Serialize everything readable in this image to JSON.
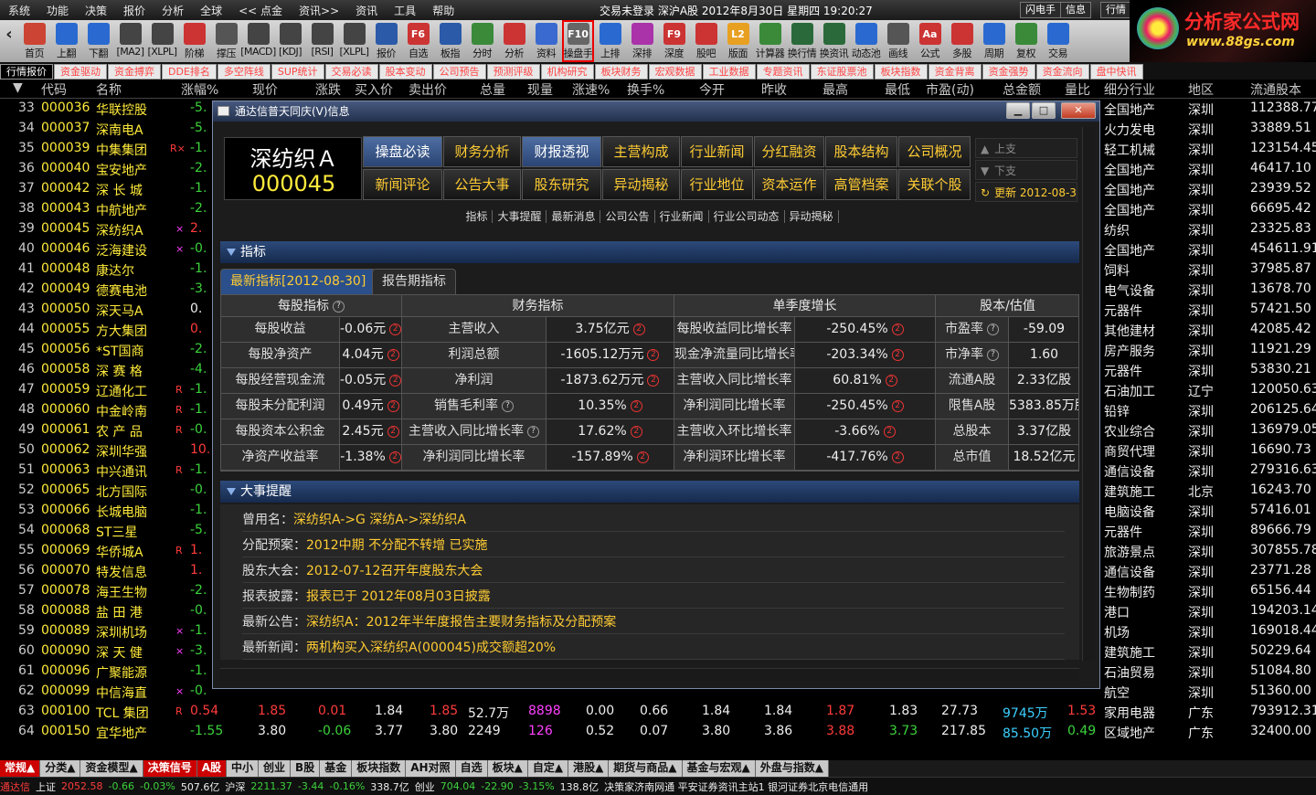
{
  "menu": [
    "系统",
    "功能",
    "决策",
    "报价",
    "分析",
    "全球",
    "<< 点金",
    "资讯>>",
    "资讯",
    "工具",
    "帮助"
  ],
  "window_title": "交易未登录   深沪A股  2012年8月30日  星期四  19:20:27",
  "right_buttons": [
    "闪电手",
    "信息",
    "行情"
  ],
  "logo": {
    "l1": "分析家公式网",
    "l2": "www.88gs.com"
  },
  "toolbar": [
    {
      "label": "首页",
      "icon": "home-icon",
      "color": "#c43"
    },
    {
      "label": "上翻",
      "icon": "arrow-up-icon",
      "color": "#2a6ad0"
    },
    {
      "label": "下翻",
      "icon": "arrow-down-icon",
      "color": "#2a6ad0"
    },
    {
      "label": "[MA2]",
      "icon": "ma-chart-icon",
      "color": "#444"
    },
    {
      "label": "[XLPL]",
      "icon": "xlpl-chart-icon",
      "color": "#444"
    },
    {
      "label": "阶梯",
      "icon": "step-chart-icon",
      "color": "#c33"
    },
    {
      "label": "撑压",
      "icon": "support-chart-icon",
      "color": "#555"
    },
    {
      "label": "[MACD]",
      "icon": "macd-icon",
      "color": "#444"
    },
    {
      "label": "[KDJ]",
      "icon": "kdj-icon",
      "color": "#444"
    },
    {
      "label": "[RSI]",
      "icon": "rsi-icon",
      "color": "#444"
    },
    {
      "label": "[XLPL]",
      "icon": "xlpl-icon",
      "color": "#444"
    },
    {
      "label": "报价",
      "icon": "yen-icon",
      "color": "#2a5aa8"
    },
    {
      "label": "自选",
      "icon": "f6-icon",
      "color": "#c33",
      "txt": "F6"
    },
    {
      "label": "板指",
      "icon": "pie-icon",
      "color": "#2a5aa8"
    },
    {
      "label": "分时",
      "icon": "timeline-icon",
      "color": "#3a8a3a"
    },
    {
      "label": "分析",
      "icon": "analysis-icon",
      "color": "#c33"
    },
    {
      "label": "资料",
      "icon": "doc-icon",
      "color": "#3a6ad0"
    },
    {
      "label": "操盘手",
      "icon": "f10-icon",
      "color": "#666",
      "txt": "F10",
      "selected": true
    },
    {
      "label": "上排",
      "icon": "rank-up-icon",
      "color": "#2a6ad0"
    },
    {
      "label": "深排",
      "icon": "rank-sz-icon",
      "color": "#a3a"
    },
    {
      "label": "深度",
      "icon": "f9-icon",
      "color": "#c33",
      "txt": "F9"
    },
    {
      "label": "股吧",
      "icon": "forum-icon",
      "color": "#c33"
    },
    {
      "label": "版面",
      "icon": "l2-icon",
      "color": "#e8a020",
      "txt": "L2"
    },
    {
      "label": "计算器",
      "icon": "calculator-icon",
      "color": "#3a8a3a"
    },
    {
      "label": "换行情",
      "icon": "switch-quote-icon",
      "color": "#2a6a3a"
    },
    {
      "label": "换资讯",
      "icon": "switch-news-icon",
      "color": "#2a6a3a"
    },
    {
      "label": "动态池",
      "icon": "pool-icon",
      "color": "#2a6ad0"
    },
    {
      "label": "画线",
      "icon": "draw-line-icon",
      "color": "#555"
    },
    {
      "label": "公式",
      "icon": "formula-icon",
      "color": "#c33",
      "txt": "Aa"
    },
    {
      "label": "多股",
      "icon": "multi-stock-icon",
      "color": "#c33"
    },
    {
      "label": "周期",
      "icon": "cycle-icon",
      "color": "#2a6ad0"
    },
    {
      "label": "复权",
      "icon": "adjust-icon",
      "color": "#3a8a3a"
    },
    {
      "label": "交易",
      "icon": "trade-icon",
      "color": "#2a6ad0"
    }
  ],
  "top_tabs": [
    "行情报价",
    "资金驱动",
    "资金搏弈",
    "DDE排名",
    "多空阵线",
    "SUP统计",
    "交易必读",
    "股本变动",
    "公司预告",
    "预测评级",
    "机构研究",
    "板块财务",
    "宏观数据",
    "工业数据",
    "专题资讯",
    "东证股票池",
    "板块指数",
    "资金背离",
    "资金强势",
    "资金流向",
    "盘中快讯"
  ],
  "columns": [
    "代码",
    "名称",
    "涨幅%",
    "现价",
    "涨跌",
    "买入价",
    "卖出价",
    "总量",
    "现量",
    "涨速%",
    "换手%",
    "今开",
    "昨收",
    "最高",
    "最低",
    "市盈(动)",
    "总金额",
    "量比",
    "细分行业",
    "地区",
    "流通股本"
  ],
  "rows": [
    {
      "no": "33",
      "code": "000036",
      "name": "华联控股",
      "chg": "-5.",
      "ind": "全国地产",
      "area": "深圳",
      "cap": "112388.77"
    },
    {
      "no": "34",
      "code": "000037",
      "name": "深南电A",
      "chg": "-5.",
      "ind": "火力发电",
      "area": "深圳",
      "cap": "33889.51"
    },
    {
      "no": "35",
      "code": "000039",
      "name": "中集集团",
      "flag": "R×",
      "chg": "-1.",
      "ind": "轻工机械",
      "area": "深圳",
      "cap": "123154.45"
    },
    {
      "no": "36",
      "code": "000040",
      "name": "宝安地产",
      "chg": "-2.",
      "ind": "全国地产",
      "area": "深圳",
      "cap": "46417.10"
    },
    {
      "no": "37",
      "code": "000042",
      "name": "深 长 城",
      "chg": "-1.",
      "ind": "全国地产",
      "area": "深圳",
      "cap": "23939.52"
    },
    {
      "no": "38",
      "code": "000043",
      "name": "中航地产",
      "chg": "-2.",
      "ind": "全国地产",
      "area": "深圳",
      "cap": "66695.42"
    },
    {
      "no": "39",
      "code": "000045",
      "name": "深纺织A",
      "flag": "×",
      "chg": "2.",
      "up": true,
      "ind": "纺织",
      "area": "深圳",
      "cap": "23325.83"
    },
    {
      "no": "40",
      "code": "000046",
      "name": "泛海建设",
      "flag": "×",
      "chg": "-0.",
      "ind": "全国地产",
      "area": "深圳",
      "cap": "454611.91"
    },
    {
      "no": "41",
      "code": "000048",
      "name": "康达尔",
      "chg": "-1.",
      "ind": "饲料",
      "area": "深圳",
      "cap": "37985.87"
    },
    {
      "no": "42",
      "code": "000049",
      "name": "德赛电池",
      "chg": "-3.",
      "ind": "电气设备",
      "area": "深圳",
      "cap": "13678.70"
    },
    {
      "no": "43",
      "code": "000050",
      "name": "深天马A",
      "chg": "0.",
      "flat": true,
      "ind": "元器件",
      "area": "深圳",
      "cap": "57421.50"
    },
    {
      "no": "44",
      "code": "000055",
      "name": "方大集团",
      "chg": "0.",
      "up": true,
      "ind": "其他建材",
      "area": "深圳",
      "cap": "42085.42"
    },
    {
      "no": "45",
      "code": "000056",
      "name": "*ST国商",
      "chg": "-2.",
      "ind": "房产服务",
      "area": "深圳",
      "cap": "11921.29"
    },
    {
      "no": "46",
      "code": "000058",
      "name": "深 赛 格",
      "chg": "-4.",
      "ind": "元器件",
      "area": "深圳",
      "cap": "53830.21"
    },
    {
      "no": "47",
      "code": "000059",
      "name": "辽通化工",
      "flag": "R",
      "chg": "-1.",
      "ind": "石油加工",
      "area": "辽宁",
      "cap": "120050.63"
    },
    {
      "no": "48",
      "code": "000060",
      "name": "中金岭南",
      "flag": "R",
      "chg": "-1.",
      "ind": "铅锌",
      "area": "深圳",
      "cap": "206125.64"
    },
    {
      "no": "49",
      "code": "000061",
      "name": "农 产 品",
      "flag": "R",
      "chg": "-0.",
      "ind": "农业综合",
      "area": "深圳",
      "cap": "136979.05"
    },
    {
      "no": "50",
      "code": "000062",
      "name": "深圳华强",
      "chg": "10.",
      "up": true,
      "ind": "商贸代理",
      "area": "深圳",
      "cap": "16690.73"
    },
    {
      "no": "51",
      "code": "000063",
      "name": "中兴通讯",
      "flag": "R",
      "chg": "-1.",
      "ind": "通信设备",
      "area": "深圳",
      "cap": "279316.63"
    },
    {
      "no": "52",
      "code": "000065",
      "name": "北方国际",
      "chg": "-0.",
      "ind": "建筑施工",
      "area": "北京",
      "cap": "16243.70"
    },
    {
      "no": "53",
      "code": "000066",
      "name": "长城电脑",
      "chg": "-1.",
      "ind": "电脑设备",
      "area": "深圳",
      "cap": "57416.01"
    },
    {
      "no": "54",
      "code": "000068",
      "name": "ST三星",
      "chg": "-5.",
      "ind": "元器件",
      "area": "深圳",
      "cap": "89666.79"
    },
    {
      "no": "55",
      "code": "000069",
      "name": "华侨城A",
      "flag": "R",
      "chg": "1.",
      "up": true,
      "ind": "旅游景点",
      "area": "深圳",
      "cap": "307855.78"
    },
    {
      "no": "56",
      "code": "000070",
      "name": "特发信息",
      "chg": "1.",
      "up": true,
      "ind": "通信设备",
      "area": "深圳",
      "cap": "23771.28"
    },
    {
      "no": "57",
      "code": "000078",
      "name": "海王生物",
      "chg": "-2.",
      "ind": "生物制药",
      "area": "深圳",
      "cap": "65156.44"
    },
    {
      "no": "58",
      "code": "000088",
      "name": "盐 田 港",
      "chg": "-0.",
      "ind": "港口",
      "area": "深圳",
      "cap": "194203.14"
    },
    {
      "no": "59",
      "code": "000089",
      "name": "深圳机场",
      "flag": "×",
      "chg": "-1.",
      "ind": "机场",
      "area": "深圳",
      "cap": "169018.44"
    },
    {
      "no": "60",
      "code": "000090",
      "name": "深 天 健",
      "flag": "×",
      "chg": "-3.",
      "ind": "建筑施工",
      "area": "深圳",
      "cap": "50229.64"
    },
    {
      "no": "61",
      "code": "000096",
      "name": "广聚能源",
      "chg": "-1.",
      "ind": "石油贸易",
      "area": "深圳",
      "cap": "51084.80"
    },
    {
      "no": "62",
      "code": "000099",
      "name": "中信海直",
      "flag": "×",
      "chg": "-0.",
      "ind": "航空",
      "area": "深圳",
      "cap": "51360.00"
    },
    {
      "no": "63",
      "code": "000100",
      "name": "TCL 集团",
      "flag": "R",
      "chg": "0.54",
      "up": true,
      "full": true,
      "price": "1.85",
      "delta": "0.01",
      "buy": "1.84",
      "sell": "1.85",
      "vol": "52.7万",
      "cur": "8898",
      "speed": "0.00",
      "turn": "0.66",
      "open": "1.84",
      "prev": "1.84",
      "high": "1.87",
      "low": "1.83",
      "pe": "27.73",
      "amt": "9745万",
      "ratio": "1.53",
      "ind": "家用电器",
      "area": "广东",
      "cap": "793912.31"
    },
    {
      "no": "64",
      "code": "000150",
      "name": "宜华地产",
      "chg": "-1.55",
      "full": true,
      "price": "3.80",
      "delta": "-0.06",
      "buy": "3.77",
      "sell": "3.80",
      "vol": "2249",
      "cur": "126",
      "speed": "0.52",
      "turn": "0.07",
      "open": "3.80",
      "prev": "3.86",
      "high": "3.88",
      "low": "3.73",
      "pe": "217.85",
      "amt": "85.50万",
      "ratio": "0.49",
      "ind": "区域地产",
      "area": "广东",
      "cap": "32400.00"
    }
  ],
  "bottom_tabs": [
    "常规▲",
    "分类▲",
    "资金模型▲",
    "决策信号",
    "A股",
    "中小",
    "创业",
    "B股",
    "基金",
    "板块指数",
    "AH对照",
    "自选",
    "板块▲",
    "自定▲",
    "港股▲",
    "期货与商品▲",
    "基金与宏观▲",
    "外盘与指数▲"
  ],
  "status": {
    "brand": "通达信",
    "sh_label": "上证",
    "sh": "2052.58",
    "sh_d": "-0.66",
    "sh_p": "-0.03%",
    "sh_amt": "507.6亿",
    "hs_label": "沪深",
    "hs": "2211.37",
    "hs_d": "-3.44",
    "hs_p": "-0.16%",
    "hs_amt": "338.7亿",
    "cy_label": "创业",
    "cy": "704.04",
    "cy_d": "-22.90",
    "cy_p": "-3.15%",
    "cy_amt": "138.8亿",
    "news": "决策家济南网通  平安证券资讯主站1  银河证券北京电信通用"
  },
  "dialog": {
    "title": "通达信普天同庆(V)信息",
    "stock_name": "深纺织Ａ",
    "stock_code": "000045",
    "nav_row1": [
      "操盘必读",
      "财务分析",
      "财报透视",
      "主营构成",
      "行业新闻",
      "分红融资",
      "股本结构",
      "公司概况"
    ],
    "nav_row2": [
      "新闻评论",
      "公告大事",
      "股东研究",
      "异动揭秘",
      "行业地位",
      "资本运作",
      "高管档案",
      "关联个股"
    ],
    "side": [
      "上支",
      "下支",
      "更新 2012-08-30"
    ],
    "sublinks": [
      "指标",
      "大事提醒",
      "最新消息",
      "公司公告",
      "行业新闻",
      "行业公司动态",
      "异动揭秘"
    ],
    "sec1": "指标",
    "tab_a": "最新指标[2012-08-30]",
    "tab_b": "报告期指标",
    "grid_heads": [
      "每股指标",
      "财务指标",
      "单季度增长",
      "股本/估值"
    ],
    "grid": [
      [
        "每股收益",
        "-0.06元",
        "主营收入",
        "3.75亿元",
        "每股收益同比增长率",
        "-250.45%",
        "市盈率",
        "-59.09"
      ],
      [
        "每股净资产",
        "4.04元",
        "利润总额",
        "-1605.12万元",
        "现金净流量同比增长率",
        "-203.34%",
        "市净率",
        "1.60"
      ],
      [
        "每股经营现金流",
        "-0.05元",
        "净利润",
        "-1873.62万元",
        "主营收入同比增长率",
        "60.81%",
        "流通A股",
        "2.33亿股"
      ],
      [
        "每股未分配利润",
        "0.49元",
        "销售毛利率",
        "10.35%",
        "净利润同比增长率",
        "-250.45%",
        "限售A股",
        "5383.85万股"
      ],
      [
        "每股资本公积金",
        "2.45元",
        "主营收入同比增长率",
        "17.62%",
        "主营收入环比增长率",
        "-3.66%",
        "总股本",
        "3.37亿股"
      ],
      [
        "净资产收益率",
        "-1.38%",
        "净利润同比增长率",
        "-157.89%",
        "净利润环比增长率",
        "-417.76%",
        "总市值",
        "18.52亿元"
      ]
    ],
    "sec2": "大事提醒",
    "events": [
      {
        "k": "曾用名：",
        "v": "深纺织A->G 深纺A->深纺织A"
      },
      {
        "k": "分配预案：",
        "v": "2012中期  不分配不转增  已实施"
      },
      {
        "k": "股东大会：",
        "v": "2012-07-12召开年度股东大会"
      },
      {
        "k": "报表披露：",
        "v": "报表已于  2012年08月03日披露"
      },
      {
        "k": "最新公告：",
        "v": "深纺织A：2012年半年度报告主要财务指标及分配预案"
      },
      {
        "k": "最新新闻：",
        "v": "两机构买入深纺织A(000045)成交额超20%"
      }
    ]
  }
}
